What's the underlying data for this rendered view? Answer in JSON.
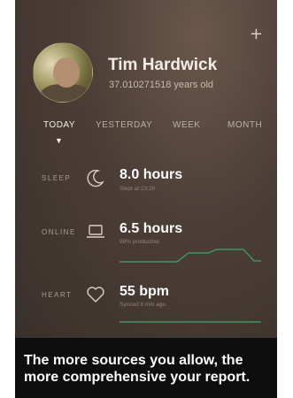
{
  "header": {
    "add_icon": "+"
  },
  "profile": {
    "name": "Tim Hardwick",
    "age": "37.010271518 years old"
  },
  "tabs": [
    {
      "label": "TODAY",
      "active": true
    },
    {
      "label": "YESTERDAY",
      "active": false
    },
    {
      "label": "WEEK",
      "active": false
    },
    {
      "label": "MONTH",
      "active": false
    }
  ],
  "metrics": {
    "sleep": {
      "label": "SLEEP",
      "icon": "moon-icon",
      "value": "8.0 hours",
      "sub": "Slept at 23:29"
    },
    "online": {
      "label": "ONLINE",
      "icon": "laptop-icon",
      "value": "6.5 hours",
      "sub": "99% productive"
    },
    "heart": {
      "label": "HEART",
      "icon": "heart-icon",
      "value": "55 bpm",
      "sub": "Synced 8 min ago"
    }
  },
  "caption": "The more sources you allow, the more comprehensive your report.",
  "colors": {
    "graph": "#3fa56a"
  }
}
